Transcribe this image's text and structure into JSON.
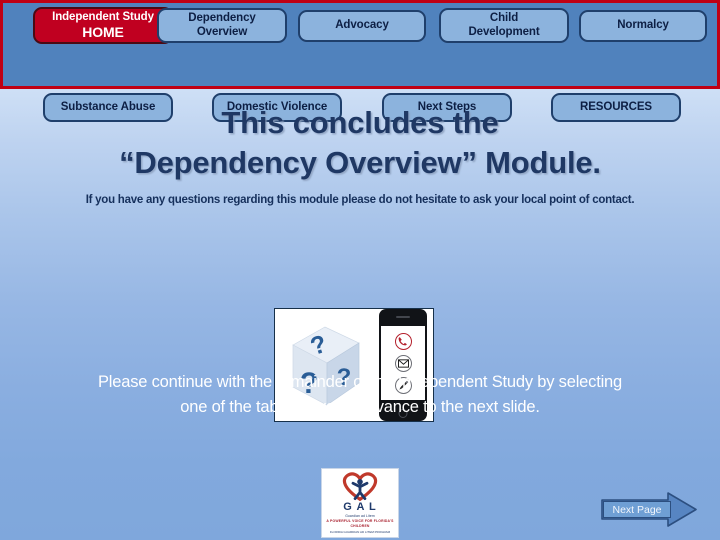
{
  "nav": {
    "row1": [
      {
        "name": "home",
        "lines": [
          "Independent Study",
          "HOME"
        ],
        "active": true
      },
      {
        "name": "dependency-overview",
        "lines": [
          "Dependency",
          "Overview"
        ],
        "active": false
      },
      {
        "name": "advocacy",
        "lines": [
          "Advocacy"
        ],
        "active": false
      },
      {
        "name": "child-development",
        "lines": [
          "Child",
          "Development"
        ],
        "active": false
      },
      {
        "name": "normalcy",
        "lines": [
          "Normalcy"
        ],
        "active": false
      }
    ],
    "row2": [
      {
        "name": "substance-abuse",
        "lines": [
          "Substance Abuse"
        ],
        "active": false
      },
      {
        "name": "domestic-violence",
        "lines": [
          "Domestic Violence"
        ],
        "active": false
      },
      {
        "name": "next-steps",
        "lines": [
          "Next Steps"
        ],
        "active": false
      },
      {
        "name": "resources",
        "lines": [
          "RESOURCES"
        ],
        "active": false
      }
    ]
  },
  "headline": {
    "line1": "This concludes the",
    "line2": "“Dependency Overview” Module."
  },
  "subtitle": "If you have any questions regarding this module please do not hesitate to ask your local point of contact.",
  "instruction": {
    "line1": "Please continue with the remainder of the Independent Study by selecting",
    "line2": "one of the tabs above or advance to the next slide."
  },
  "picture": {
    "cube_glyph": "?",
    "phone_icons": [
      "phone-icon",
      "envelope-icon",
      "pencil-icon"
    ]
  },
  "logo": {
    "title": "G A L",
    "sub1": "Guardian ad Litem",
    "sub2": "A POWERFUL VOICE FOR FLORIDA’S CHILDREN",
    "sub3": "FLORIDA GUARDIAN AD LITEM PROGRAM"
  },
  "next_page": {
    "label": "Next Page"
  },
  "colors": {
    "frame_red": "#c00014",
    "nav_background": "#5082bd",
    "tab_fill": "#8cb3dd",
    "tab_border": "#1f3f6b",
    "home_tab_fill": "#c00020",
    "headline_text": "#1f3864",
    "instruction_text": "#ffffff",
    "arrow_fill": "#5785c2",
    "arrow_border": "#2c4f80"
  }
}
